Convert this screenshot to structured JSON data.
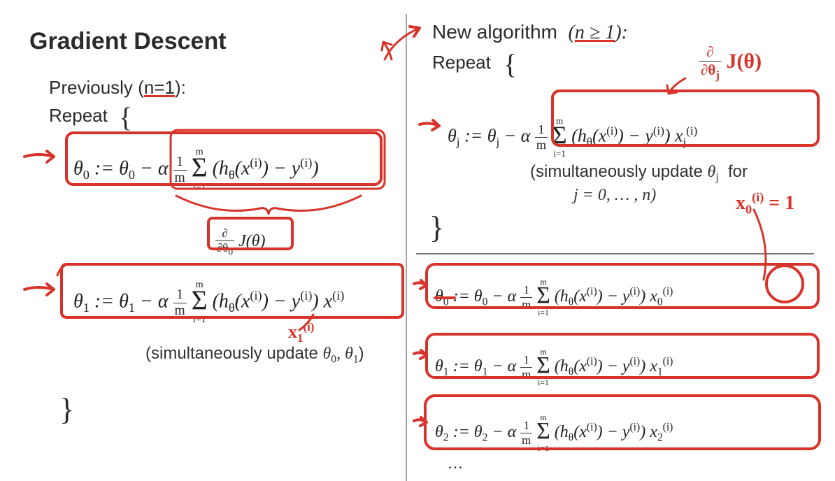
{
  "title": "Gradient Descent",
  "left": {
    "prev_label": "Previously (",
    "prev_n": "n=1",
    "prev_close": "):",
    "repeat": "Repeat",
    "brace_open": "{",
    "theta0": "θ₀ := θ₀ − α (1/m) Σᵢ₌₁ᵐ (h_θ(x⁽ⁱ⁾) − y⁽ⁱ⁾)",
    "deriv_label": "∂/∂θ₀ J(θ)",
    "theta1": "θ₁ := θ₁ − α (1/m) Σᵢ₌₁ᵐ (h_θ(x⁽ⁱ⁾) − y⁽ⁱ⁾) x⁽ⁱ⁾",
    "simul": "(simultaneously update θ₀, θ₁)",
    "brace_close": "}",
    "hand_x1": "x₁⁽ⁱ⁾"
  },
  "right": {
    "new_algo": "New algorithm",
    "n_ge1": "(n ≥ 1):",
    "repeat": "Repeat",
    "brace_open": "{",
    "thetaj": "θⱼ := θⱼ − α (1/m) Σᵢ₌₁ᵐ (h_θ(x⁽ⁱ⁾) − y⁽ⁱ⁾) xⱼ⁽ⁱ⁾",
    "simul1": "(simultaneously update θⱼ for",
    "simul2": "j = 0, … , n)",
    "brace_close": "}",
    "hand_deriv": "∂/∂θⱼ J(θ)",
    "hand_x0": "x₀⁽ⁱ⁾ = 1",
    "theta0": "θ₀ := θ₀ − α (1/m) Σᵢ₌₁ᵐ (h_θ(x⁽ⁱ⁾) − y⁽ⁱ⁾) x₀⁽ⁱ⁾",
    "theta1": "θ₁ := θ₁ − α (1/m) Σᵢ₌₁ᵐ (h_θ(x⁽ⁱ⁾) − y⁽ⁱ⁾) x₁⁽ⁱ⁾",
    "theta2": "θ₂ := θ₂ − α (1/m) Σᵢ₌₁ᵐ (h_θ(x⁽ⁱ⁾) − y⁽ⁱ⁾) x₂⁽ⁱ⁾",
    "dots": "…"
  },
  "annotations": {
    "arrows": [
      "left-theta0",
      "left-theta1",
      "right-thetaj",
      "right-theta0",
      "right-theta1",
      "right-theta2",
      "to-new-algo"
    ],
    "boxes": [
      "left-theta0-box",
      "left-deriv-box",
      "left-theta1-box",
      "right-thetaj-box",
      "right-theta0-box",
      "right-theta1-box",
      "right-theta2-box"
    ],
    "underlines": [
      "n=1",
      "n≥1",
      "θ₀-right"
    ],
    "circles": [
      "x0-right"
    ]
  }
}
